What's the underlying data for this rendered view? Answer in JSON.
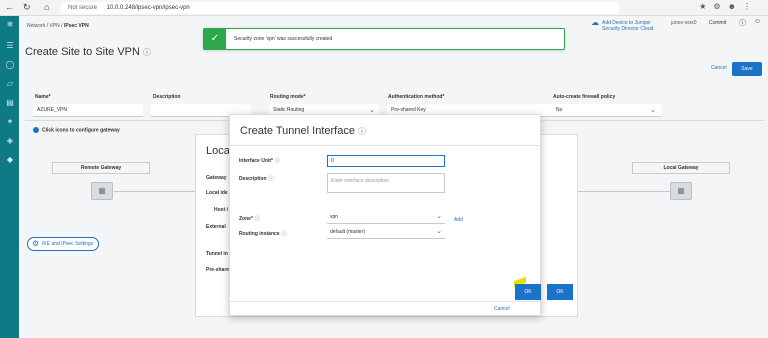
{
  "browser": {
    "not_secure": "Not secure",
    "url": "10.0.0.248/ipsec-vpn/ipsec-vpn"
  },
  "header": {
    "breadcrumb": [
      "Network",
      "VPN",
      "IPsec VPN"
    ],
    "add_device": "Add Device to Juniper Security Director Cloud",
    "user": "junos-vsrx0",
    "commit": "Commit"
  },
  "toast": {
    "message": "Security zone 'vpn' was successfully created"
  },
  "page": {
    "title": "Create Site to Site VPN",
    "cancel": "Cancel",
    "save": "Save"
  },
  "form": {
    "name_label": "Name*",
    "name_value": "AZURE_VPN",
    "description_label": "Description",
    "routing_label": "Routing mode*",
    "routing_value": "Static Routing",
    "auth_label": "Authentication method*",
    "auth_value": "Pre-shared Key",
    "autofw_label": "Auto-create firewall policy",
    "autofw_value": "No"
  },
  "canvas": {
    "hint": "Click icons to configure gateway",
    "local_title": "Local",
    "remote_gateway": "Remote Gateway",
    "local_gateway": "Local Gateway",
    "ike_button": "IKE and IPsec Settings",
    "labels": [
      "Gateway",
      "Local ide",
      "Host i",
      "External",
      "Tunnel in",
      "Pre-share"
    ]
  },
  "modal": {
    "title": "Create Tunnel Interface",
    "unit_label": "Interface Unit*",
    "unit_value": "0",
    "desc_label": "Description",
    "desc_placeholder": "Enter interface description",
    "zone_label": "Zone*",
    "zone_value": "vpn",
    "add_link": "Add",
    "ri_label": "Routing instance",
    "ri_value": "default (master)",
    "cancel": "Cancel",
    "ok": "OK"
  }
}
